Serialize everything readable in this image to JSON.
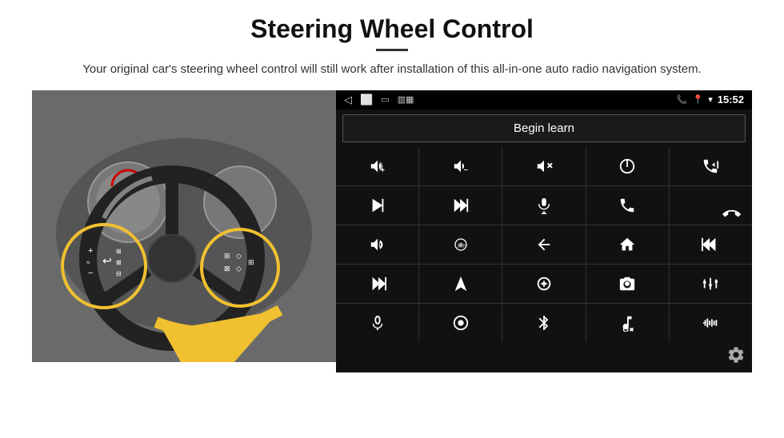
{
  "page": {
    "title": "Steering Wheel Control",
    "subtitle": "Your original car's steering wheel control will still work after installation of this all-in-one auto radio navigation system.",
    "divider": true
  },
  "status_bar": {
    "time": "15:52",
    "left_icons": [
      "back-arrow",
      "home-square",
      "recents-square",
      "signal-bars"
    ],
    "right_icons": [
      "phone-icon",
      "location-icon",
      "wifi-icon",
      "time-display"
    ]
  },
  "begin_learn": {
    "label": "Begin learn"
  },
  "controls": {
    "rows": [
      [
        {
          "icon": "vol-up-icon",
          "symbol": "🔊+"
        },
        {
          "icon": "vol-down-icon",
          "symbol": "🔉−"
        },
        {
          "icon": "mute-icon",
          "symbol": "🔇"
        },
        {
          "icon": "power-icon",
          "symbol": "⏻"
        },
        {
          "icon": "prev-track-icon",
          "symbol": "📞⏮"
        }
      ],
      [
        {
          "icon": "skip-forward-icon",
          "symbol": "⏭"
        },
        {
          "icon": "play-pause-icon",
          "symbol": "⏯▶"
        },
        {
          "icon": "mic-icon",
          "symbol": "🎤"
        },
        {
          "icon": "phone-pick-icon",
          "symbol": "📞"
        },
        {
          "icon": "phone-hang-icon",
          "symbol": "📵"
        }
      ],
      [
        {
          "icon": "horn-icon",
          "symbol": "📢"
        },
        {
          "icon": "rotate360-icon",
          "symbol": "360°"
        },
        {
          "icon": "back-icon",
          "symbol": "↩"
        },
        {
          "icon": "home-icon",
          "symbol": "🏠"
        },
        {
          "icon": "rewind-icon",
          "symbol": "⏮⏮"
        }
      ],
      [
        {
          "icon": "fast-forward-icon",
          "symbol": "⏭⏭"
        },
        {
          "icon": "navigation-icon",
          "symbol": "▲"
        },
        {
          "icon": "eject-icon",
          "symbol": "⏏"
        },
        {
          "icon": "camera-icon",
          "symbol": "📷"
        },
        {
          "icon": "equalizer-icon",
          "symbol": "🎛"
        }
      ],
      [
        {
          "icon": "microphone2-icon",
          "symbol": "🎙"
        },
        {
          "icon": "record-icon",
          "symbol": "⏺"
        },
        {
          "icon": "bluetooth-icon",
          "symbol": "✦"
        },
        {
          "icon": "music-settings-icon",
          "symbol": "🎵⚙"
        },
        {
          "icon": "waveform-icon",
          "symbol": "📶"
        }
      ]
    ]
  },
  "gear": {
    "label": "⚙"
  }
}
